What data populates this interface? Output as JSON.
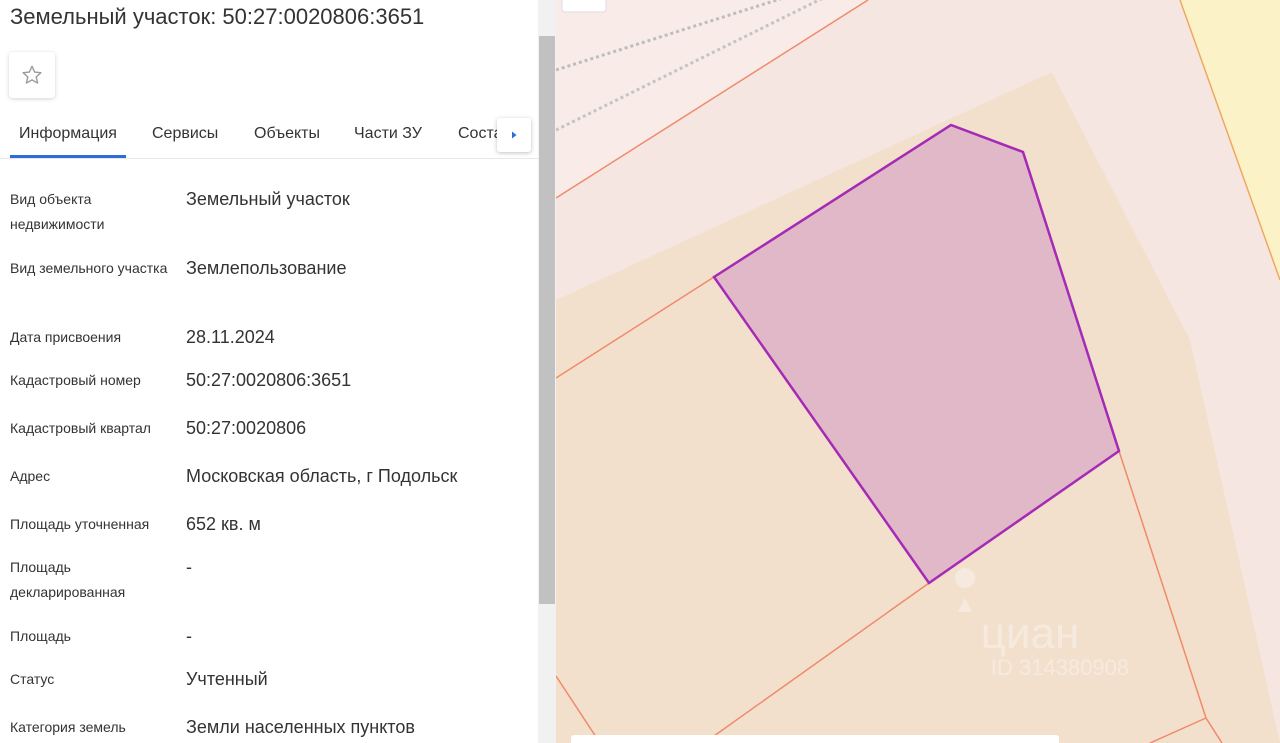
{
  "header": {
    "title": "Земельный участок: 50:27:0020806:3651"
  },
  "tabs": [
    {
      "label": "Информация",
      "active": true
    },
    {
      "label": "Сервисы"
    },
    {
      "label": "Объекты"
    },
    {
      "label": "Части ЗУ"
    },
    {
      "label": "Состав"
    }
  ],
  "info": [
    {
      "label": "Вид объекта недвижимости",
      "value": "Земельный участок"
    },
    {
      "label": "Вид земельного участка",
      "value": "Землепользование"
    },
    {
      "label": "Дата присвоения",
      "value": "28.11.2024"
    },
    {
      "label": "Кадастровый номер",
      "value": "50:27:0020806:3651"
    },
    {
      "label": "Кадастровый квартал",
      "value": "50:27:0020806"
    },
    {
      "label": "Адрес",
      "value": "Московская область, г Подольск"
    },
    {
      "label": "Площадь уточненная",
      "value": "652 кв. м"
    },
    {
      "label": "Площадь декларированная",
      "value": "-"
    },
    {
      "label": "Площадь",
      "value": "-"
    },
    {
      "label": "Статус",
      "value": "Учтенный"
    },
    {
      "label": "Категория земель",
      "value": "Земли населенных пунктов"
    }
  ],
  "map": {
    "watermark_brand": "циан",
    "watermark_id": "ID 314380908",
    "colors": {
      "parcel_fill": "#e0b8c8",
      "parcel_stroke": "#a52ab5",
      "boundary": "#f08a6a",
      "block_fill": "#f2e0cd",
      "road_fill": "#f6e6e2",
      "yellow_zone": "#fbf2c8"
    }
  },
  "icons": {
    "favorite": "star-outline-icon",
    "tabs_next": "triangle-right-icon"
  }
}
